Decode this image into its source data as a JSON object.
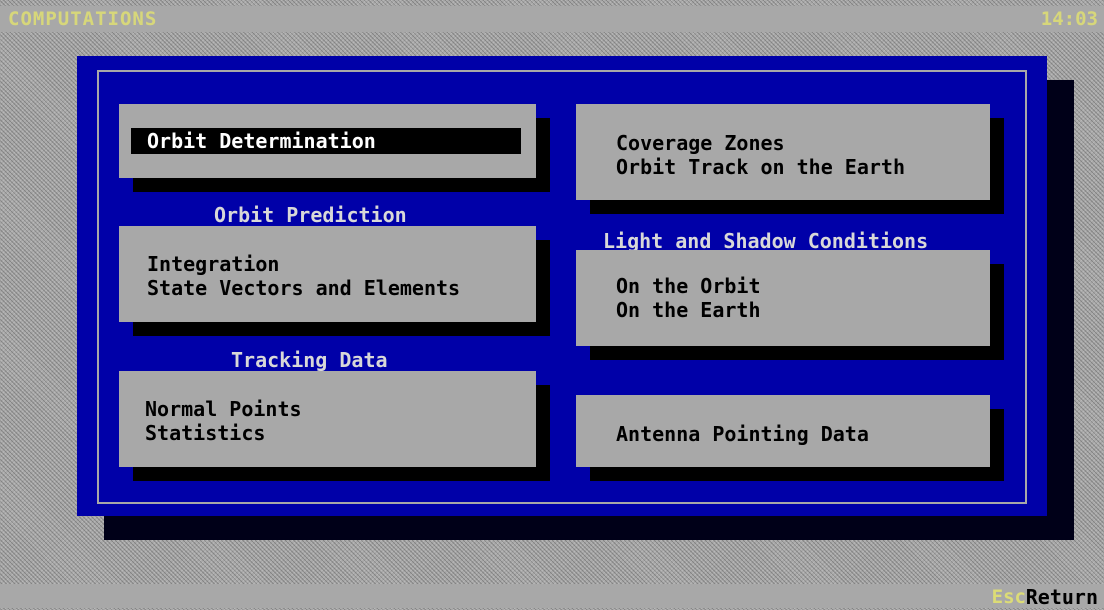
{
  "header": {
    "title": "COMPUTATIONS",
    "clock": "14:03"
  },
  "footer": {
    "key": "Esc",
    "label": "Return"
  },
  "menu": {
    "orbit_determination": "Orbit Determination",
    "orbit_prediction": {
      "heading": "Orbit Prediction",
      "items": [
        "Integration",
        "State Vectors and Elements"
      ]
    },
    "tracking_data": {
      "heading": "Tracking Data",
      "items": [
        "Normal Points",
        "Statistics"
      ]
    },
    "coverage": {
      "items": [
        "Coverage Zones",
        "Orbit Track on the Earth"
      ]
    },
    "light_shadow": {
      "heading": "Light and Shadow Conditions",
      "items": [
        "On the Orbit",
        "On the Earth"
      ]
    },
    "antenna": {
      "items": [
        "Antenna Pointing Data"
      ]
    }
  },
  "colors": {
    "panel": "#0000a8",
    "box": "#a8a8a8",
    "highlight": "#000000",
    "status_text": "#ffff55"
  }
}
